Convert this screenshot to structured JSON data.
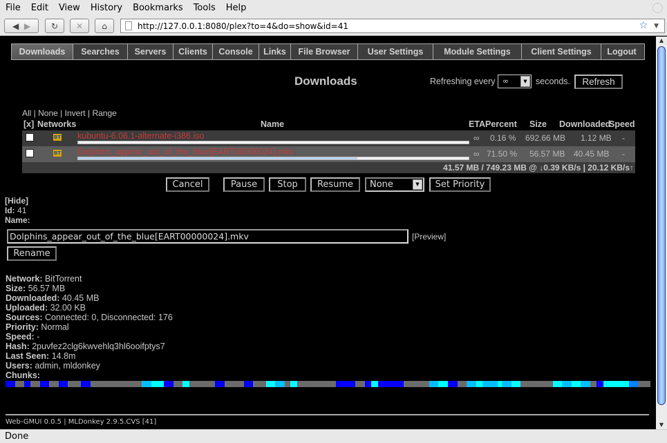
{
  "browser": {
    "menu": [
      "File",
      "Edit",
      "View",
      "History",
      "Bookmarks",
      "Tools",
      "Help"
    ],
    "url": "http://127.0.0.1:8080/plex?to=4&do=show&id=41",
    "status": "Done"
  },
  "tabs": [
    {
      "label": "Downloads",
      "active": true
    },
    {
      "label": "Searches"
    },
    {
      "label": "Servers"
    },
    {
      "label": "Clients"
    },
    {
      "label": "Console"
    },
    {
      "label": "Links"
    },
    {
      "label": "File Browser"
    },
    {
      "label": "User Settings"
    },
    {
      "label": "Module Settings"
    },
    {
      "label": "Client Settings"
    },
    {
      "label": "Logout"
    }
  ],
  "header": {
    "title": "Downloads",
    "refreshing_label": "Refreshing every",
    "refresh_value": "∞",
    "seconds_label": "seconds.",
    "refresh_button": "Refresh"
  },
  "selection_links": [
    "All",
    "None",
    "Invert",
    "Range"
  ],
  "table": {
    "columns": [
      "[x]",
      "Networks",
      "Name",
      "ETA",
      "Percent",
      "Size",
      "Downloaded",
      "Speed"
    ],
    "rows": [
      {
        "network": "BT",
        "name": "kubuntu-6.06.1-alternate-i386.iso",
        "progress": 0.0016,
        "eta": "∞",
        "percent": "0.16 %",
        "size": "692.66 MB",
        "downloaded": "1.12 MB",
        "speed": "-"
      },
      {
        "network": "BT",
        "name": "Dolphins_appear_out_of_the_blue[EART00000024].mkv",
        "progress": 0.715,
        "eta": "∞",
        "percent": "71.50 %",
        "size": "56.57 MB",
        "downloaded": "40.45 MB",
        "speed": "-"
      }
    ],
    "totals": "41.57 MB / 749.23 MB @ ↓0.39 KB/s | 20.12 KB/s↑"
  },
  "actions": {
    "cancel": "Cancel",
    "pause": "Pause",
    "stop": "Stop",
    "resume": "Resume",
    "priority_value": "None",
    "set_priority": "Set Priority"
  },
  "detail": {
    "hide": "[Hide]",
    "id_label": "Id:",
    "id_value": "41",
    "name_label": "Name:",
    "name_value": "Dolphins_appear_out_of_the_blue[EART00000024].mkv",
    "preview": "[Preview]",
    "rename": "Rename",
    "info": [
      {
        "label": "Network:",
        "value": "BitTorrent"
      },
      {
        "label": "Size:",
        "value": "56.57 MB"
      },
      {
        "label": "Downloaded:",
        "value": "40.45 MB"
      },
      {
        "label": "Uploaded:",
        "value": "32.00 KB"
      },
      {
        "label": "Sources:",
        "value": "Connected: 0, Disconnected: 176"
      },
      {
        "label": "Priority:",
        "value": "Normal"
      },
      {
        "label": "Speed:",
        "value": "-"
      },
      {
        "label": "Hash:",
        "value": "2puvfez2clg6kwvehlq3hl6ooifptys7"
      },
      {
        "label": "Last Seen:",
        "value": "14.8m"
      },
      {
        "label": "Users:",
        "value": "admin, mldonkey"
      },
      {
        "label": "Chunks:",
        "value": ""
      }
    ],
    "chunk_colors": {
      "B": "#0000ff",
      "G": "#6b6b6b",
      "L": "#00bfff",
      "C": "#00ffff",
      "M": "#0080ff"
    },
    "chunks": [
      [
        "B",
        14
      ],
      [
        "G",
        13
      ],
      [
        "B",
        9
      ],
      [
        "G",
        14
      ],
      [
        "B",
        13
      ],
      [
        "G",
        14
      ],
      [
        "B",
        13
      ],
      [
        "G",
        19
      ],
      [
        "B",
        14
      ],
      [
        "G",
        74
      ],
      [
        "L",
        14
      ],
      [
        "C",
        18
      ],
      [
        "B",
        14
      ],
      [
        "G",
        13
      ],
      [
        "C",
        10
      ],
      [
        "G",
        37
      ],
      [
        "B",
        14
      ],
      [
        "G",
        28
      ],
      [
        "B",
        13
      ],
      [
        "G",
        19
      ],
      [
        "C",
        13
      ],
      [
        "L",
        14
      ],
      [
        "G",
        8
      ],
      [
        "C",
        10
      ],
      [
        "G",
        56
      ],
      [
        "B",
        28
      ],
      [
        "G",
        14
      ],
      [
        "B",
        9
      ],
      [
        "C",
        10
      ],
      [
        "B",
        37
      ],
      [
        "G",
        37
      ],
      [
        "L",
        13
      ],
      [
        "C",
        14
      ],
      [
        "B",
        14
      ],
      [
        "G",
        13
      ],
      [
        "L",
        14
      ],
      [
        "C",
        9
      ],
      [
        "L",
        22
      ],
      [
        "C",
        6
      ],
      [
        "L",
        14
      ],
      [
        "C",
        13
      ],
      [
        "G",
        47
      ],
      [
        "C",
        13
      ],
      [
        "L",
        14
      ],
      [
        "C",
        13
      ],
      [
        "L",
        14
      ],
      [
        "G",
        9
      ],
      [
        "B",
        10
      ],
      [
        "C",
        37
      ],
      [
        "M",
        13
      ],
      [
        "G",
        18
      ]
    ]
  },
  "footer": "Web-GMUI 0.0.5 | MLDonkey 2.9.5.CVS [41]"
}
